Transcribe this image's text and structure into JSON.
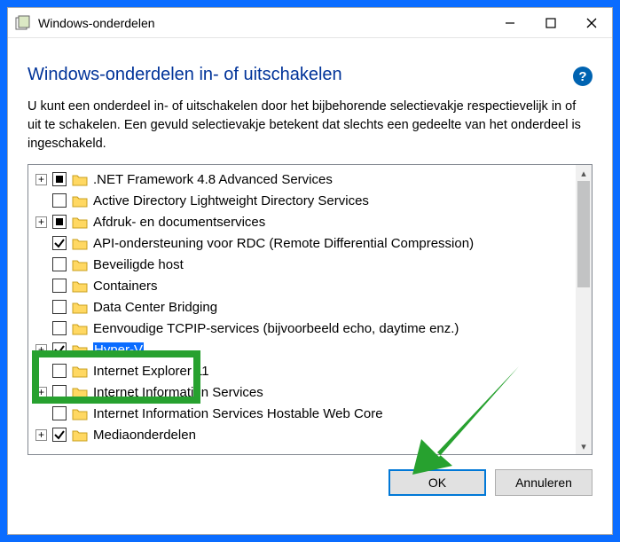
{
  "window": {
    "title": "Windows-onderdelen"
  },
  "heading": "Windows-onderdelen in- of uitschakelen",
  "help_symbol": "?",
  "description": "U kunt een onderdeel in- of uitschakelen door het bijbehorende selectievakje respectievelijk in of uit te schakelen. Een gevuld selectievakje betekent dat slechts een gedeelte van het onderdeel is ingeschakeld.",
  "tree": {
    "items": [
      {
        "expander": "+",
        "check": "partial",
        "label": ".NET Framework 4.8 Advanced Services"
      },
      {
        "expander": "",
        "check": "none",
        "label": "Active Directory Lightweight Directory Services"
      },
      {
        "expander": "+",
        "check": "partial",
        "label": "Afdruk- en documentservices"
      },
      {
        "expander": "",
        "check": "checked",
        "label": "API-ondersteuning voor RDC (Remote Differential Compression)"
      },
      {
        "expander": "",
        "check": "none",
        "label": "Beveiligde host"
      },
      {
        "expander": "",
        "check": "none",
        "label": "Containers"
      },
      {
        "expander": "",
        "check": "none",
        "label": "Data Center Bridging"
      },
      {
        "expander": "",
        "check": "none",
        "label": "Eenvoudige TCPIP-services (bijvoorbeeld echo, daytime enz.)",
        "obscured": true,
        "visible_suffix": "CPIP-services (bijvoorbeeld echo, daytime enz.)"
      },
      {
        "expander": "+",
        "check": "checked",
        "label": "Hyper-V",
        "selected": true
      },
      {
        "expander": "",
        "check": "none",
        "label": "Internet Explorer 11",
        "obscured": true,
        "visible_suffix": "er 11"
      },
      {
        "expander": "+",
        "check": "none",
        "label": "Internet Information Services"
      },
      {
        "expander": "",
        "check": "none",
        "label": "Internet Information Services Hostable Web Core",
        "truncated": true,
        "visible_prefix": "Internet Information Services Hostable Web Co"
      },
      {
        "expander": "+",
        "check": "checked",
        "label": "Mediaonderdelen"
      }
    ]
  },
  "buttons": {
    "ok": "OK",
    "cancel": "Annuleren"
  },
  "scrollbar": {
    "up": "▴",
    "down": "▾"
  },
  "annotations": {
    "green_rectangle_highlights": "Hyper-V row",
    "green_arrow_points_to": "OK button"
  }
}
